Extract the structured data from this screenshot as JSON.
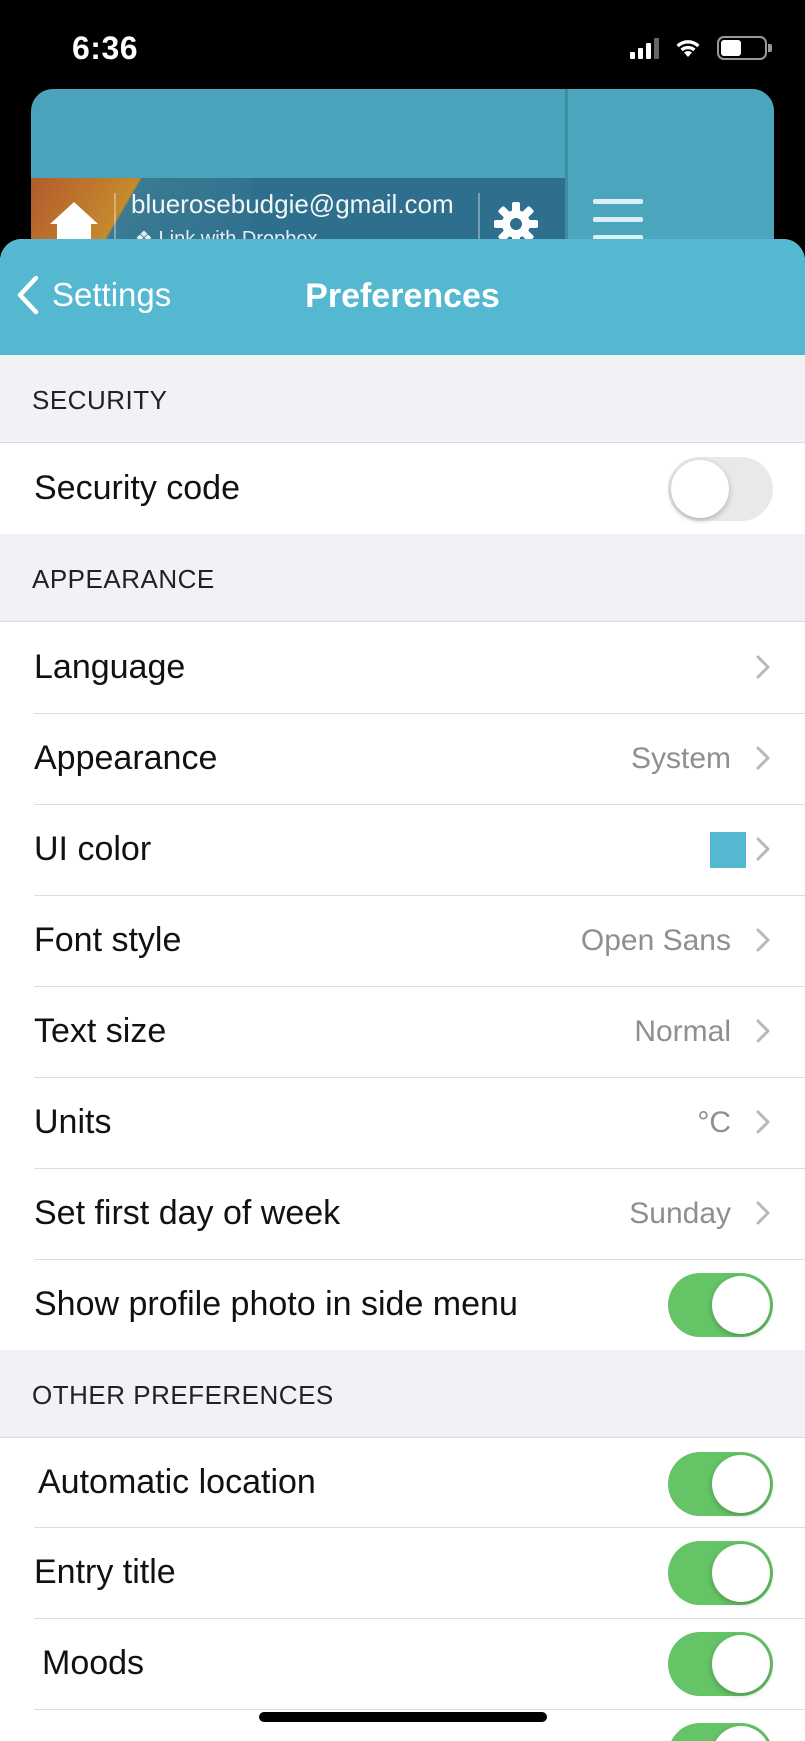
{
  "status_bar": {
    "time": "6:36"
  },
  "background_app": {
    "email": "bluerosebudgie@gmail.com",
    "dropbox_link": "Link with Dropbox"
  },
  "nav": {
    "back_label": "Settings",
    "title": "Preferences"
  },
  "sections": {
    "security": {
      "header": "SECURITY",
      "security_code": {
        "label": "Security code",
        "toggle_on": false
      }
    },
    "appearance": {
      "header": "APPEARANCE",
      "language": {
        "label": "Language"
      },
      "appearance": {
        "label": "Appearance",
        "value": "System"
      },
      "ui_color": {
        "label": "UI color",
        "color": "#53b8d0"
      },
      "font_style": {
        "label": "Font style",
        "value": "Open Sans"
      },
      "text_size": {
        "label": "Text size",
        "value": "Normal"
      },
      "units": {
        "label": "Units",
        "value": "°C"
      },
      "first_day": {
        "label": "Set first day of week",
        "value": "Sunday"
      },
      "profile_photo": {
        "label": "Show profile photo in side menu",
        "toggle_on": true
      }
    },
    "other": {
      "header": "OTHER PREFERENCES",
      "automatic_location": {
        "label": "Automatic location",
        "toggle_on": true
      },
      "entry_title": {
        "label": "Entry title",
        "toggle_on": true
      },
      "moods": {
        "label": "Moods",
        "toggle_on": true
      }
    }
  },
  "colors": {
    "accent": "#53b8d0",
    "toggle_on": "#65c466",
    "toggle_off": "#e9e9eb"
  }
}
